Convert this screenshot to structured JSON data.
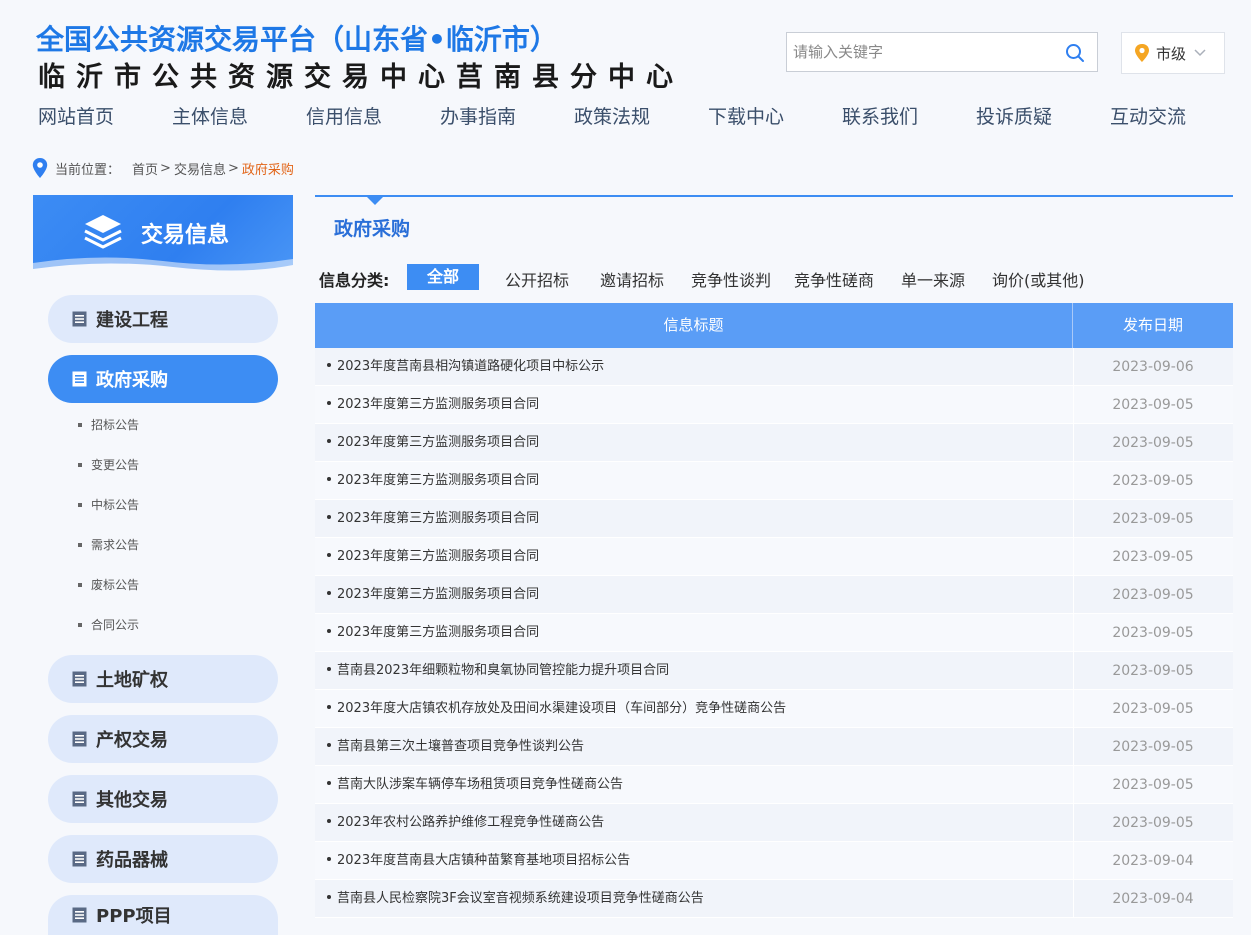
{
  "header": {
    "title_line1": "全国公共资源交易平台（山东省•临沂市）",
    "title_line2": "临沂市公共资源交易中心莒南县分中心",
    "search_placeholder": "请输入关键字",
    "search_icon": "search-icon",
    "city_icon": "location-pin-icon",
    "city_label": "市级",
    "accent_color": "#1e78e6"
  },
  "nav": {
    "items": [
      {
        "label": "网站首页"
      },
      {
        "label": "主体信息"
      },
      {
        "label": "信用信息"
      },
      {
        "label": "办事指南"
      },
      {
        "label": "政策法规"
      },
      {
        "label": "下载中心"
      },
      {
        "label": "联系我们"
      },
      {
        "label": "投诉质疑"
      },
      {
        "label": "互动交流"
      }
    ]
  },
  "breadcrumb": {
    "label": "当前位置：",
    "items": [
      "首页",
      "交易信息"
    ],
    "current": "政府采购",
    "current_color": "#e2661a"
  },
  "sidebar": {
    "header_title": "交易信息",
    "header_icon": "layers-icon",
    "menu": [
      {
        "label": "建设工程"
      },
      {
        "label": "政府采购"
      },
      {
        "label": "土地矿权"
      },
      {
        "label": "产权交易"
      },
      {
        "label": "其他交易"
      },
      {
        "label": "药品器械"
      },
      {
        "label": "PPP项目"
      }
    ],
    "submenu": [
      "招标公告",
      "变更公告",
      "中标公告",
      "需求公告",
      "废标公告",
      "合同公示"
    ],
    "active_color": "#3d8df3"
  },
  "main": {
    "title": "政府采购",
    "filter_label": "信息分类:",
    "filter_options": [
      "全部",
      "公开招标",
      "邀请招标",
      "竞争性谈判",
      "竞争性磋商",
      "单一来源",
      "询价(或其他)"
    ],
    "table_headers": [
      "信息标题",
      "发布日期"
    ],
    "rows": [
      {
        "title": "2023年度莒南县相沟镇道路硬化项目中标公示",
        "date": "2023-09-06"
      },
      {
        "title": "2023年度第三方监测服务项目合同",
        "date": "2023-09-05"
      },
      {
        "title": "2023年度第三方监测服务项目合同",
        "date": "2023-09-05"
      },
      {
        "title": "2023年度第三方监测服务项目合同",
        "date": "2023-09-05"
      },
      {
        "title": "2023年度第三方监测服务项目合同",
        "date": "2023-09-05"
      },
      {
        "title": "2023年度第三方监测服务项目合同",
        "date": "2023-09-05"
      },
      {
        "title": "2023年度第三方监测服务项目合同",
        "date": "2023-09-05"
      },
      {
        "title": "2023年度第三方监测服务项目合同",
        "date": "2023-09-05"
      },
      {
        "title": "莒南县2023年细颗粒物和臭氧协同管控能力提升项目合同",
        "date": "2023-09-05"
      },
      {
        "title": "2023年度大店镇农机存放处及田间水渠建设项目（车间部分）竞争性磋商公告",
        "date": "2023-09-05"
      },
      {
        "title": "莒南县第三次土壤普查项目竞争性谈判公告",
        "date": "2023-09-05"
      },
      {
        "title": "莒南大队涉案车辆停车场租赁项目竞争性磋商公告",
        "date": "2023-09-05"
      },
      {
        "title": "2023年农村公路养护维修工程竞争性磋商公告",
        "date": "2023-09-05"
      },
      {
        "title": "2023年度莒南县大店镇种苗繁育基地项目招标公告",
        "date": "2023-09-04"
      },
      {
        "title": "莒南县人民检察院3F会议室音视频系统建设项目竞争性磋商公告",
        "date": "2023-09-04"
      }
    ]
  }
}
